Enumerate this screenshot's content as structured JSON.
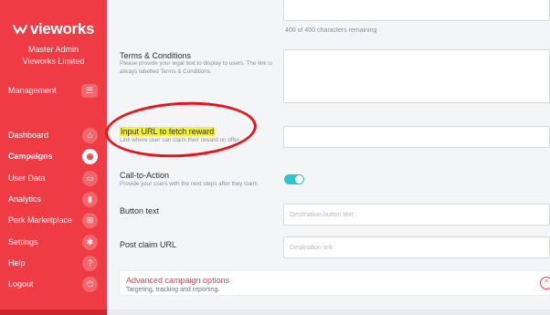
{
  "sidebar": {
    "brand": "vieworks",
    "role": "Master Admin",
    "company": "Vieworks Limited",
    "items": [
      {
        "label": "Management",
        "icon": "menu-icon",
        "glyph": "☰"
      },
      {
        "label": "Dashboard",
        "icon": "home-icon",
        "glyph": "⌂"
      },
      {
        "label": "Campaigns",
        "icon": "megaphone-icon",
        "glyph": "◉"
      },
      {
        "label": "User Data",
        "icon": "id-card-icon",
        "glyph": "▭"
      },
      {
        "label": "Analytics",
        "icon": "bar-chart-icon",
        "glyph": "▮"
      },
      {
        "label": "Perk Marketplace",
        "icon": "gift-icon",
        "glyph": "⊞"
      },
      {
        "label": "Settings",
        "icon": "gear-icon",
        "glyph": "✱"
      },
      {
        "label": "Help",
        "icon": "help-icon",
        "glyph": "?"
      },
      {
        "label": "Logout",
        "icon": "power-icon",
        "glyph": "⏻"
      }
    ],
    "active": "Campaigns"
  },
  "form": {
    "chars_remaining": "400 of 400 characters remaining",
    "terms": {
      "label": "Terms & Conditions",
      "help": "Please provide your legal text to display to users. The link is always labelled Terms & Conditions."
    },
    "reward_url": {
      "label": "Input URL to fetch reward",
      "help": "Link where user can claim their reward on offer",
      "value": ""
    },
    "cta": {
      "label": "Call-to-Action",
      "help": "Provide your users with the next steps after they claim",
      "enabled": true
    },
    "button_text": {
      "label": "Button text",
      "placeholder": "Destination button text"
    },
    "post_claim_url": {
      "label": "Post claim URL",
      "placeholder": "Destination link"
    },
    "advanced": {
      "title": "Advanced campaign options",
      "subtitle": "Targeting, tracking and reporting.",
      "glyph": "^"
    }
  },
  "colors": {
    "brand_red": "#ef3b43",
    "toggle_on": "#2ec4c8",
    "annotation_red": "#e8141b",
    "highlight_yellow": "#f5f02e"
  }
}
